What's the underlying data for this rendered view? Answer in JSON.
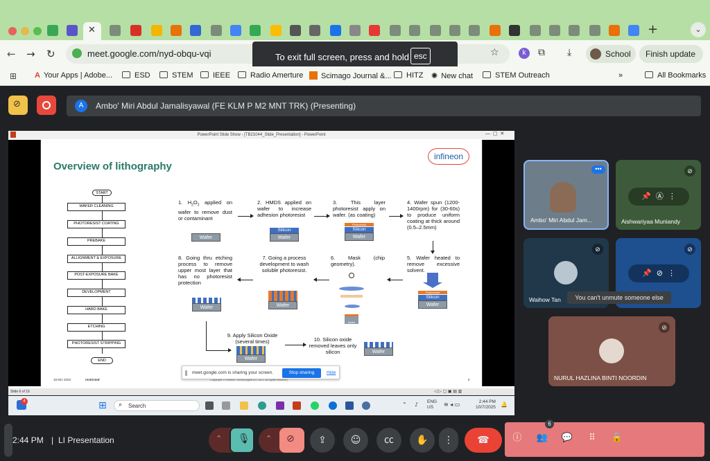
{
  "browser": {
    "url": "meet.google.com/nyd-obqu-vqi",
    "fullscreen_toast": "To exit full screen, press and hold",
    "fullscreen_key": "esc",
    "profile_label": "School",
    "update_label": "Finish update",
    "bookmarks": [
      "Your Apps | Adobe...",
      "ESD",
      "STEM",
      "IEEE",
      "Radio Amerture",
      "Scimago Journal &...",
      "HITZ",
      "New chat",
      "STEM Outreach"
    ],
    "all_bookmarks": "All Bookmarks",
    "overflow": "»"
  },
  "meet": {
    "presenter_initial": "A",
    "presenting_label": "Ambo' Miri Abdul Jamalisyawal (FE KLM P M2 MNT TRK) (Presenting)",
    "participants": [
      {
        "name": "Ambo' Miri Abdul Jam..."
      },
      {
        "name": "Aishwariyaa Muniandy"
      },
      {
        "name": "Waihow Tan"
      },
      {
        "name": "NURUL HAZLINA BINTI NOORDIN"
      }
    ],
    "tooltip": "You can't unmute someone else",
    "clock": "2:44 PM",
    "meeting_title": "LI Presentation",
    "participant_count": "6"
  },
  "ppt": {
    "window_title": "PowerPoint Slide Show - [TB21044_Slide_Presentation] - PowerPoint",
    "status": "Slide 6 of 16",
    "share_text": "meet.google.com is sharing your screen.",
    "stop_sharing": "Stop sharing",
    "hide": "Hide"
  },
  "slide": {
    "title": "Overview of lithography",
    "logo": "infineon",
    "flow": [
      "START",
      "WAFER CLEANING",
      "PHOTORESIST COATING",
      "PREBAKE",
      "ALLIGNMENT & EXPOSURE",
      "POST-EXPOSURE BAKE",
      "DEVELOPMENT",
      "HARD BAKE",
      "ETCHING",
      "PHOTORESIST STRIPPING",
      "END"
    ],
    "steps": {
      "s1a": "1. H",
      "s1b": "2",
      "s1c": "O",
      "s1d": "2",
      "s1e": " applied on wafer to remove dust or contaminant",
      "s2": "2. HMDS applied on wafer to increase adhesion photoresist",
      "s3": "3. This layer photoresist apply on wafer. (as coating)",
      "s4": "4. Wafer spun (1200-1400rpm) for (30-60s) to produce uniform coating at thick around (0.5–2.5mm)",
      "s5": "5. Wafer heated to remove excessive solvent.",
      "s6": "6. Mask (chip geometry).",
      "s7": "7. Going a process development to wash soluble photoresist.",
      "s8": "8. Going thru etching process to remove upper most layer that has no photoresist protection",
      "s9": "9. Apply Silicon Oxide (several times)",
      "s10": "10. Silicon oxide removed leaves only silicon"
    },
    "labels": {
      "wafer": "Wafer",
      "silicon": "Silicon",
      "photoresist": "Photoresist"
    },
    "footer_date": "18 Mrz 2023",
    "footer_class": "restricted",
    "footer_copy": "Copyright © Infineon Technologies AG 2023. All rights reserved.",
    "footer_page": "6"
  },
  "taskbar": {
    "search": "Search",
    "lang1": "ENG",
    "lang2": "US",
    "time": "2:44 PM",
    "date": "10/7/2025",
    "badge": "4"
  }
}
